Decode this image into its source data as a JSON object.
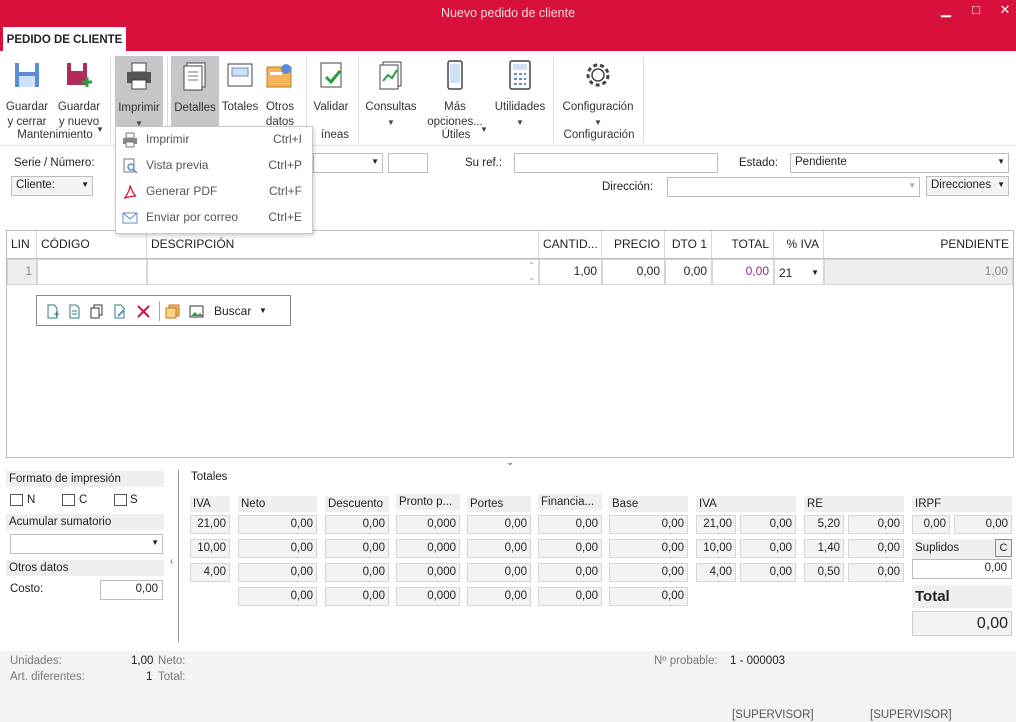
{
  "window": {
    "title": "Nuevo pedido de cliente",
    "minimize": "▁",
    "maximize": "□",
    "close": "✕"
  },
  "tab": "PEDIDO DE CLIENTE",
  "ribbon": {
    "guardar_cerrar": "Guardar\ny cerrar",
    "guardar_nuevo": "Guardar\ny nuevo",
    "imprimir": "Imprimir",
    "detalles": "Detalles",
    "totales": "Totales",
    "otros_datos": "Otros\ndatos",
    "validar": "Validar",
    "consultas": "Consultas",
    "mas_opciones": "Más\nopciones...",
    "utilidades": "Utilidades",
    "configuracion": "Configuración",
    "groups": {
      "mantenimiento": "Mantenimiento",
      "lineas": "íneas",
      "utiles": "Útiles",
      "configuracion": "Configuración"
    }
  },
  "print_menu": [
    {
      "label": "Imprimir",
      "shortcut": "Ctrl+I"
    },
    {
      "label": "Vista previa",
      "shortcut": "Ctrl+P"
    },
    {
      "label": "Generar PDF",
      "shortcut": "Ctrl+F"
    },
    {
      "label": "Enviar por correo",
      "shortcut": "Ctrl+E"
    }
  ],
  "form": {
    "serie_label": "Serie / Número:",
    "cliente_label": "Cliente:",
    "su_ref_label": "Su ref.:",
    "estado_label": "Estado:",
    "estado_value": "Pendiente",
    "direccion_label": "Dirección:",
    "direcciones_button": "Direcciones"
  },
  "grid": {
    "headers": [
      "LIN",
      "CÓDIGO",
      "DESCRIPCIÓN",
      "CANTID...",
      "PRECIO",
      "DTO 1",
      "TOTAL",
      "% IVA",
      "PENDIENTE"
    ],
    "row": {
      "lin": "1",
      "codigo": "",
      "descripcion": "",
      "cantidad": "1,00",
      "precio": "0,00",
      "dto": "0,00",
      "total": "0,00",
      "iva": "21",
      "pendiente": "1,00"
    },
    "toolbar_search": "Buscar"
  },
  "left_panel": {
    "formato": "Formato de impresión",
    "n": "N",
    "c": "C",
    "s": "S",
    "acumular": "Acumular sumatorio",
    "otros": "Otros datos",
    "costo_label": "Costo:",
    "costo": "0,00"
  },
  "totales": {
    "title": "Totales",
    "headers": {
      "iva": "IVA",
      "neto": "Neto",
      "descuento": "Descuento",
      "pronto": "Pronto p...",
      "portes": "Portes",
      "financia": "Financia...",
      "base": "Base",
      "iva2": "IVA",
      "re": "RE",
      "irpf": "IRPF"
    },
    "rows": [
      {
        "iva": "21,00",
        "neto": "0,00",
        "desc": "0,00",
        "pronto": "0,000",
        "portes": "0,00",
        "fin": "0,00",
        "base": "0,00",
        "ivap": "21,00",
        "ivav": "0,00",
        "rep": "5,20",
        "rev": "0,00"
      },
      {
        "iva": "10,00",
        "neto": "0,00",
        "desc": "0,00",
        "pronto": "0,000",
        "portes": "0,00",
        "fin": "0,00",
        "base": "0,00",
        "ivap": "10,00",
        "ivav": "0,00",
        "rep": "1,40",
        "rev": "0,00"
      },
      {
        "iva": "4,00",
        "neto": "0,00",
        "desc": "0,00",
        "pronto": "0,000",
        "portes": "0,00",
        "fin": "0,00",
        "base": "0,00",
        "ivap": "4,00",
        "ivav": "0,00",
        "rep": "0,50",
        "rev": "0,00"
      },
      {
        "iva": "",
        "neto": "0,00",
        "desc": "0,00",
        "pronto": "0,000",
        "portes": "0,00",
        "fin": "0,00",
        "base": "0,00"
      }
    ],
    "irpf_p": "0,00",
    "irpf_v": "0,00",
    "suplidos_label": "Suplidos",
    "suplidos_btn": "C",
    "suplidos": "0,00",
    "total_label": "Total",
    "total": "0,00"
  },
  "status": {
    "unidades_label": "Unidades:",
    "unidades": "1,00",
    "neto_label": "Neto:",
    "art_label": "Art. diferentes:",
    "art": "1",
    "total_label": "Total:",
    "nprob_label": "Nº probable:",
    "nprob": "1 - 000003",
    "user1": "[SUPERVISOR]",
    "user2": "[SUPERVISOR]"
  }
}
